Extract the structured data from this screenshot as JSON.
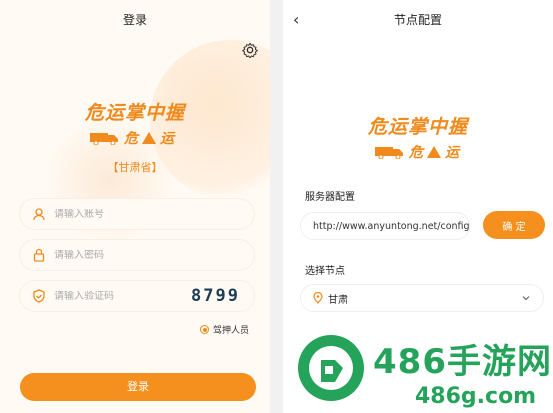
{
  "login_screen": {
    "title": "登录",
    "brand_title": "危运掌中握",
    "brand_sub": "危",
    "brand_sub2": "运",
    "province": "【甘肃省】",
    "username_placeholder": "请输入账号",
    "password_placeholder": "请输入密码",
    "captcha_placeholder": "请输入验证码",
    "captcha_code": "8799",
    "role_label": "驾押人员",
    "login_button": "登录",
    "accent_color": "#f5901e"
  },
  "node_screen": {
    "title": "节点配置",
    "brand_title": "危运掌中握",
    "brand_sub": "危",
    "brand_sub2": "运",
    "server_label": "服务器配置",
    "server_url": "http://www.anyuntong.net/configs",
    "confirm_button": "确 定",
    "node_label": "选择节点",
    "node_value": "甘肃"
  },
  "watermark": {
    "big_text": "486手游网",
    "small_text": "486g.com",
    "color": "#25a35a"
  }
}
